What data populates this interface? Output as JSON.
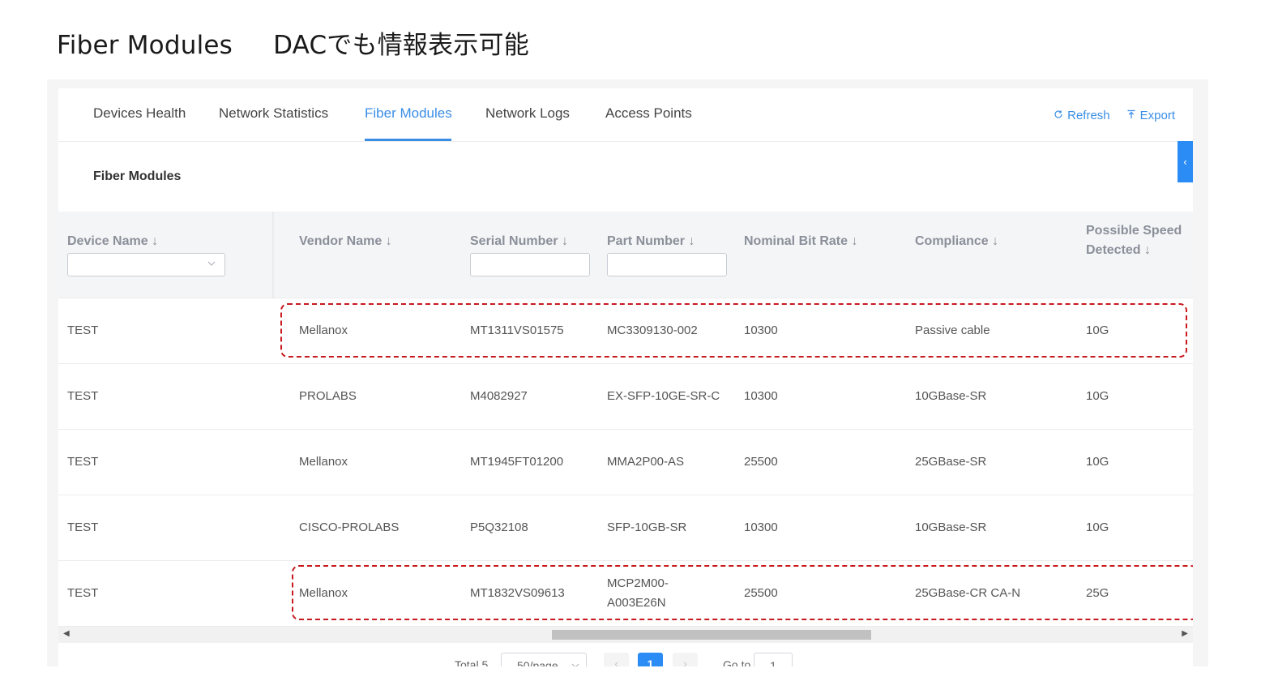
{
  "slide": {
    "title": "Fiber Modules",
    "subtitle": "DACでも情報表示可能"
  },
  "tabs": [
    {
      "label": "Devices Health"
    },
    {
      "label": "Network Statistics"
    },
    {
      "label": "Fiber Modules",
      "active": true
    },
    {
      "label": "Network Logs"
    },
    {
      "label": "Access Points"
    }
  ],
  "actions": {
    "refresh_label": "Refresh",
    "export_label": "Export"
  },
  "section_title": "Fiber Modules",
  "table": {
    "columns": [
      {
        "label": "Device Name",
        "sort_arrow": "↓",
        "filter": "select"
      },
      {
        "label": "Vendor Name",
        "sort_arrow": "↓",
        "filter": "none"
      },
      {
        "label": "Serial Number",
        "sort_arrow": "↓",
        "filter": "input"
      },
      {
        "label": "Part Number",
        "sort_arrow": "↓",
        "filter": "input"
      },
      {
        "label": "Nominal Bit Rate",
        "sort_arrow": "↓",
        "filter": "none"
      },
      {
        "label": "Compliance",
        "sort_arrow": "↓",
        "filter": "none"
      },
      {
        "label_line1": "Possible Speed",
        "label_line2": "Detected",
        "sort_arrow": "↓",
        "filter": "none"
      }
    ],
    "rows": [
      {
        "device": "TEST",
        "vendor": "Mellanox",
        "serial": "MT1311VS01575",
        "part": "MC3309130-002",
        "part_line2": "",
        "bitrate": "10300",
        "compliance": "Passive cable",
        "speed": "10G",
        "highlighted": true
      },
      {
        "device": "TEST",
        "vendor": "PROLABS",
        "serial": "M4082927",
        "part": "EX-SFP-10GE-SR-C",
        "part_line2": "",
        "bitrate": "10300",
        "compliance": "10GBase-SR",
        "speed": "10G",
        "highlighted": false
      },
      {
        "device": "TEST",
        "vendor": "Mellanox",
        "serial": "MT1945FT01200",
        "part": "MMA2P00-AS",
        "part_line2": "",
        "bitrate": "25500",
        "compliance": "25GBase-SR",
        "speed": "10G",
        "highlighted": false
      },
      {
        "device": "TEST",
        "vendor": "CISCO-PROLABS",
        "serial": "P5Q32108",
        "part": "SFP-10GB-SR",
        "part_line2": "",
        "bitrate": "10300",
        "compliance": "10GBase-SR",
        "speed": "10G",
        "highlighted": false
      },
      {
        "device": "TEST",
        "vendor": "Mellanox",
        "serial": "MT1832VS09613",
        "part": "MCP2M00-",
        "part_line2": "A003E26N",
        "bitrate": "25500",
        "compliance": "25GBase-CR CA-N",
        "speed": "25G",
        "highlighted": true
      }
    ]
  },
  "pagination": {
    "total_label": "Total 5",
    "page_size": "50/page",
    "current_page": "1",
    "goto_label": "Go to",
    "goto_value": "1"
  },
  "colors": {
    "accent": "#3a8ee6",
    "highlight_border": "#c8191e"
  }
}
